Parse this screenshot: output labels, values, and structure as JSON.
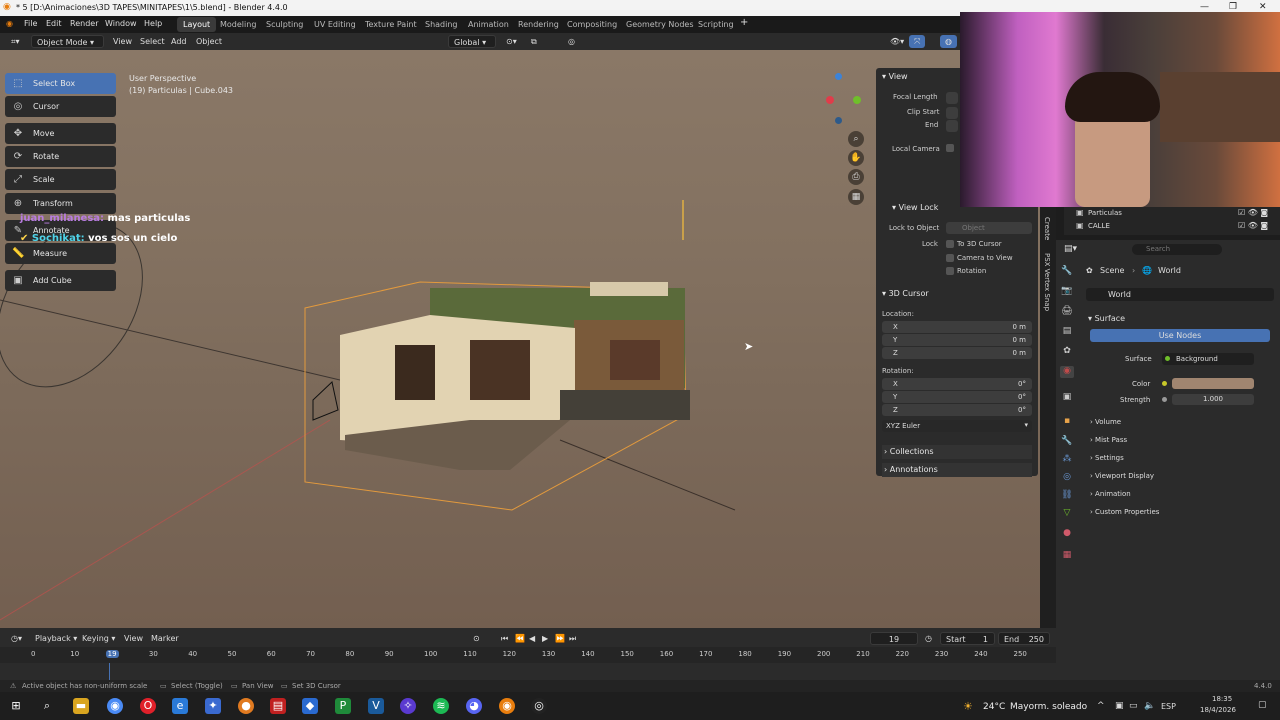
{
  "window": {
    "title": "* 5 [D:\\Animaciones\\3D TAPES\\MINITAPES\\1\\5.blend] - Blender 4.4.0"
  },
  "menu": [
    "File",
    "Edit",
    "Render",
    "Window",
    "Help"
  ],
  "workspaces": [
    "Layout",
    "Modeling",
    "Sculpting",
    "UV Editing",
    "Texture Paint",
    "Shading",
    "Animation",
    "Rendering",
    "Compositing",
    "Geometry Nodes",
    "Scripting"
  ],
  "viewport_header": {
    "mode": "Object Mode",
    "view": "View",
    "select": "Select",
    "add": "Add",
    "object": "Object",
    "orientation": "Global"
  },
  "overlay_text": {
    "perspective": "User Perspective",
    "object_info": "(19) Particulas | Cube.043"
  },
  "tools": [
    "Select Box",
    "Cursor",
    "Move",
    "Rotate",
    "Scale",
    "Transform",
    "Annotate",
    "Measure",
    "Add Cube"
  ],
  "chat": [
    {
      "user": "juan_milanesa:",
      "msg": "mas particulas"
    },
    {
      "user": "Sochikat:",
      "msg": "vos sos un cielo"
    }
  ],
  "npanel": {
    "view_header": "View",
    "focal_length": "Focal Length",
    "clip_start": "Clip Start",
    "end": "End",
    "local_camera": "Local Camera",
    "view_lock_header": "View Lock",
    "lock_to_object": "Lock to Object",
    "object_placeholder": "Object",
    "lock": "Lock",
    "to_3d_cursor": "To 3D Cursor",
    "camera_to_view": "Camera to View",
    "rotation_chk": "Rotation",
    "cursor_header": "3D Cursor",
    "location": "Location:",
    "rotation": "Rotation:",
    "loc": [
      {
        "axis": "X",
        "value": "0 m"
      },
      {
        "axis": "Y",
        "value": "0 m"
      },
      {
        "axis": "Z",
        "value": "0 m"
      }
    ],
    "rot": [
      {
        "axis": "X",
        "value": "0°"
      },
      {
        "axis": "Y",
        "value": "0°"
      },
      {
        "axis": "Z",
        "value": "0°"
      }
    ],
    "euler": "XYZ Euler",
    "collections": "Collections",
    "annotations": "Annotations"
  },
  "side_tabs": [
    "Create",
    "PSX Vertex Snap"
  ],
  "outliner": [
    {
      "name": "Particulas"
    },
    {
      "name": "CALLE"
    }
  ],
  "properties": {
    "search_placeholder": "Search",
    "breadcrumb_scene": "Scene",
    "breadcrumb_world": "World",
    "world_name": "World",
    "surface_header": "Surface",
    "use_nodes": "Use Nodes",
    "surface_label": "Surface",
    "surface_value": "Background",
    "color_label": "Color",
    "color_value": "#a08570",
    "strength_label": "Strength",
    "strength_value": "1.000",
    "sections": [
      "Volume",
      "Mist Pass",
      "Settings",
      "Viewport Display",
      "Animation",
      "Custom Properties"
    ]
  },
  "timeline": {
    "playback": "Playback",
    "keying": "Keying",
    "view": "View",
    "marker": "Marker",
    "current_frame": "19",
    "start_label": "Start",
    "start": "1",
    "end_label": "End",
    "end": "250",
    "ticks": [
      "0",
      "10",
      "19",
      "30",
      "40",
      "50",
      "60",
      "70",
      "80",
      "90",
      "100",
      "110",
      "120",
      "130",
      "140",
      "150",
      "160",
      "170",
      "180",
      "190",
      "200",
      "210",
      "220",
      "230",
      "240",
      "250"
    ]
  },
  "status": {
    "warning": "Active object has non-uniform scale",
    "select": "Select (Toggle)",
    "pan": "Pan View",
    "cursor": "Set 3D Cursor",
    "version": "4.4.0"
  },
  "taskbar": {
    "weather_temp": "24°C",
    "weather_desc": "Mayorm. soleado",
    "lang": "ESP",
    "time": "18:35",
    "date": "18/4/2026"
  }
}
